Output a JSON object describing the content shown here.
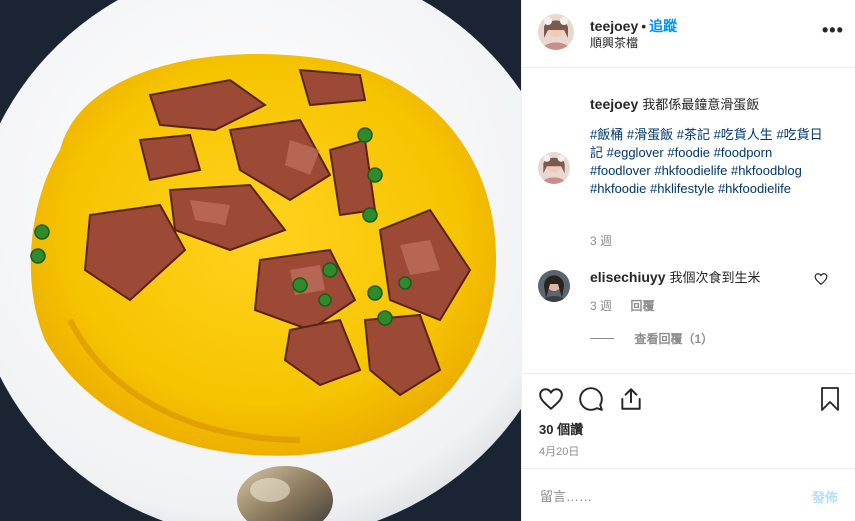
{
  "colors": {
    "link": "#0095f6",
    "hashtag": "#00376b",
    "muted": "#8e8e8e",
    "text": "#262626",
    "post_disabled": "#b2dffc"
  },
  "photo": {
    "description_icon": "food-photo"
  },
  "header": {
    "username": "teejoey",
    "separator": "•",
    "follow_label": "追蹤",
    "location": "順興茶檔",
    "more_icon": "more-options-icon",
    "more_label": "•••"
  },
  "caption": {
    "username": "teejoey",
    "text": "我都係最鐘意滑蛋飯",
    "hashtags": [
      "#飯桶",
      "#滑蛋飯",
      "#茶記",
      "#吃貨人生",
      "#吃貨日記",
      "#egglover",
      "#foodie",
      "#foodporn",
      "#foodlover",
      "#hkfoodielife",
      "#hkfoodblog",
      "#hkfoodie",
      "#hklifestyle",
      "#hkfoodielife"
    ],
    "time": "3 週"
  },
  "comment": {
    "username": "elisechiuyy",
    "text": "我個次食到生米",
    "time": "3 週",
    "reply_label": "回覆",
    "view_replies_label": "查看回覆（1）"
  },
  "actions": {
    "icons": [
      "heart-icon",
      "comment-icon",
      "share-icon",
      "bookmark-icon"
    ],
    "likes": "30 個讚",
    "date": "4月20日"
  },
  "composer": {
    "placeholder": "留言……",
    "post_label": "發佈"
  }
}
